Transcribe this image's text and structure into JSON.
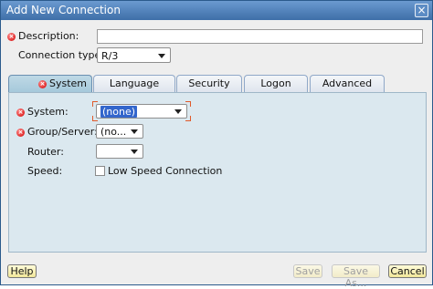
{
  "window": {
    "title": "Add New Connection",
    "close_glyph": "×"
  },
  "form": {
    "description_label": "Description:",
    "description_value": "",
    "connection_type_label": "Connection type:",
    "connection_type_value": "R/3"
  },
  "tabs": [
    {
      "label": "System",
      "active": true
    },
    {
      "label": "Language",
      "active": false
    },
    {
      "label": "Security",
      "active": false
    },
    {
      "label": "Logon",
      "active": false
    },
    {
      "label": "Advanced",
      "active": false
    }
  ],
  "system_tab": {
    "system_label": "System:",
    "system_value": "(none)",
    "group_server_label": "Group/Server:",
    "group_server_value": "(no...",
    "router_label": "Router:",
    "router_value": "",
    "speed_label": "Speed:",
    "low_speed_label": "Low Speed Connection",
    "low_speed_checked": false
  },
  "buttons": {
    "help": "Help",
    "save": "Save",
    "save_as": "Save As...",
    "cancel": "Cancel"
  },
  "icons": {
    "required": "required-error-icon",
    "dropdown": "chevron-down-icon",
    "close": "close-icon"
  },
  "colors": {
    "title_bar": "#3e6fa8",
    "panel": "#dbe8ef",
    "required_marker": "#d20000",
    "button": "#f1e79a",
    "selection": "#3366cc",
    "focus": "#e05a2a"
  }
}
